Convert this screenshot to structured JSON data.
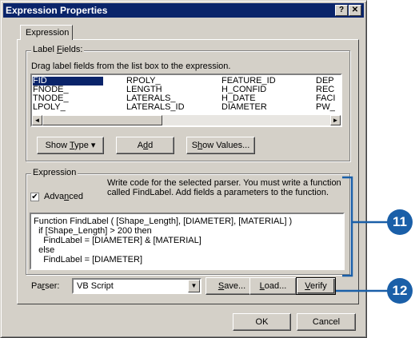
{
  "window": {
    "title": "Expression Properties",
    "help_btn": "?",
    "close_btn": "✕"
  },
  "tab": {
    "label": "Expression"
  },
  "label_fields": {
    "group_title_pre": "Label ",
    "group_title_u": "F",
    "group_title_post": "ields:",
    "instruction": "Drag label fields from the list box to the expression.",
    "columns": [
      [
        "FID",
        "FNODE_",
        "TNODE_",
        "LPOLY_"
      ],
      [
        "RPOLY_",
        "LENGTH",
        "LATERALS_",
        "LATERALS_ID"
      ],
      [
        "FEATURE_ID",
        "H_CONFID",
        "H_DATE",
        "DIAMETER"
      ],
      [
        "DEP",
        "REC",
        "FACI",
        "PW_"
      ]
    ],
    "scroll_left": "◄",
    "scroll_right": "►",
    "show_type_pre": "Show ",
    "show_type_u": "T",
    "show_type_post": "ype",
    "show_type_arrow": "▾",
    "add_pre": "A",
    "add_u": "d",
    "add_post": "d",
    "show_values_pre": "S",
    "show_values_u": "h",
    "show_values_post": "ow Values..."
  },
  "expression": {
    "group_title": "Expression",
    "advanced_check": "✔",
    "advanced_pre": "Adva",
    "advanced_u": "n",
    "advanced_post": "ced",
    "hint_line1": "Write code for the selected parser.  You must write a function",
    "hint_line2": "called FindLabel.  Add fields a parameters to the function.",
    "code": "Function FindLabel ( [Shape_Length], [DIAMETER], [MATERIAL] )\n  if [Shape_Length] > 200 then\n    FindLabel = [DIAMETER] & [MATERIAL]\n  else\n    FindLabel = [DIAMETER]"
  },
  "parser": {
    "label_pre": "Pa",
    "label_u": "r",
    "label_post": "ser:",
    "value": "VB Script",
    "dropdown_arrow": "▼",
    "save_u": "S",
    "save_post": "ave...",
    "load_u": "L",
    "load_post": "oad...",
    "verify_u": "V",
    "verify_post": "erify"
  },
  "footer": {
    "ok": "OK",
    "cancel": "Cancel"
  },
  "callouts": {
    "c1": "11",
    "c2": "12"
  },
  "colors": {
    "accent": "#1a5fa8",
    "titlebar": "#0a246a",
    "dialog": "#d4d0c8"
  }
}
